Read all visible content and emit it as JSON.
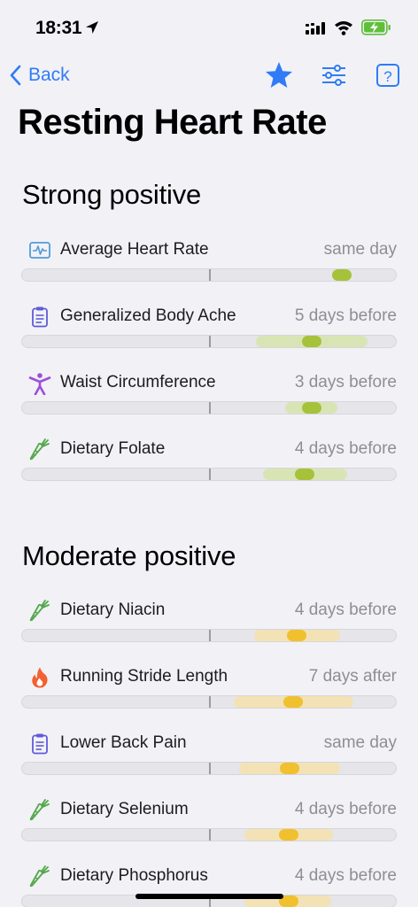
{
  "status_bar": {
    "time": "18:31"
  },
  "nav": {
    "back_label": "Back"
  },
  "page_title": "Resting Heart Rate",
  "colors": {
    "accent": "#2f7cf6",
    "strong": "#a6c23a",
    "moderate": "#f1c02e"
  },
  "sections": [
    {
      "title": "Strong positive",
      "items": [
        {
          "label": "Average Heart Rate",
          "lag": "same day",
          "icon": "heart-monitor-icon",
          "value": 0.71
        },
        {
          "label": "Generalized Body Ache",
          "lag": "5 days before",
          "icon": "clipboard-icon",
          "value": 0.6
        },
        {
          "label": "Waist Circumference",
          "lag": "3 days before",
          "icon": "person-icon",
          "value": 0.6
        },
        {
          "label": "Dietary Folate",
          "lag": "4 days before",
          "icon": "carrot-icon",
          "value": 0.52
        }
      ]
    },
    {
      "title": "Moderate positive",
      "items": [
        {
          "label": "Dietary Niacin",
          "lag": "4 days before",
          "icon": "carrot-icon",
          "value": 0.5
        },
        {
          "label": "Running Stride Length",
          "lag": "7 days after",
          "icon": "flame-icon",
          "value": 0.43
        },
        {
          "label": "Lower Back Pain",
          "lag": "same day",
          "icon": "clipboard-icon",
          "value": 0.43
        },
        {
          "label": "Dietary Selenium",
          "lag": "4 days before",
          "icon": "carrot-icon",
          "value": 0.42
        },
        {
          "label": "Dietary Phosphorus",
          "lag": "4 days before",
          "icon": "carrot-icon",
          "value": 0.42
        }
      ]
    }
  ]
}
